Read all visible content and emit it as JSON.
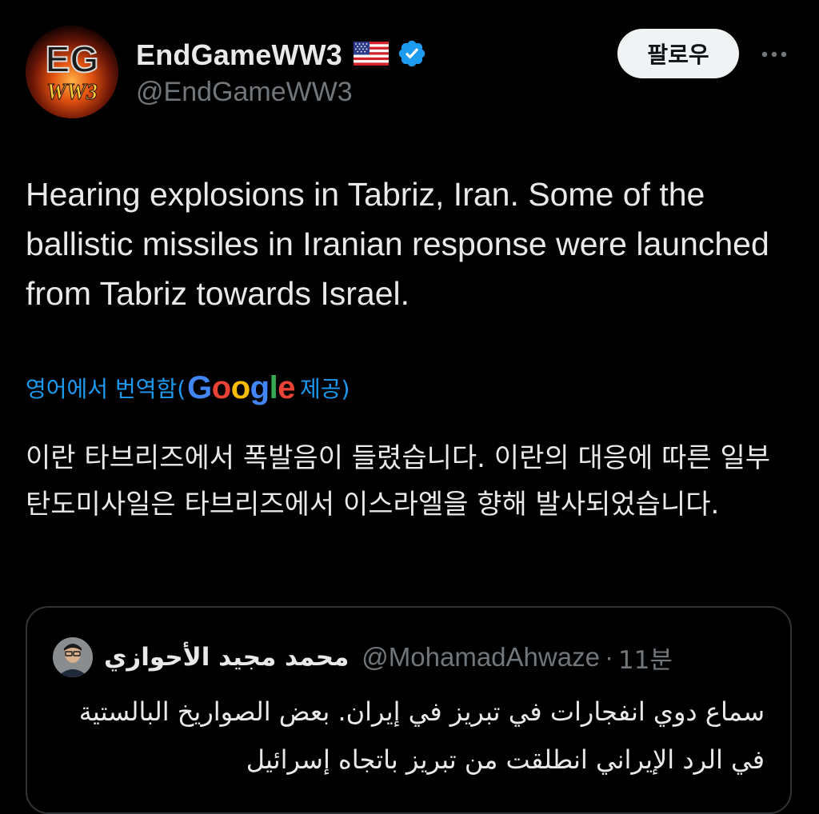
{
  "author": {
    "display_name": "EndGameWW3",
    "handle": "@EndGameWW3",
    "flag_icon": "us-flag-icon",
    "verified_icon": "verified-badge-icon",
    "avatar_text_top": "EG",
    "avatar_text_bottom": "WW3"
  },
  "actions": {
    "follow_label": "팔로우",
    "more_icon": "more-horizontal-icon"
  },
  "tweet": {
    "text": "Hearing explosions in Tabriz, Iran. Some of the ballistic missiles in Iranian response were launched from Tabriz towards Israel.",
    "translation_prefix": "영어에서 번역함(",
    "translation_provider": "Google",
    "translation_suffix": " 제공)",
    "translated_text": "이란 타브리즈에서 폭발음이 들렸습니다. 이란의 대응에 따른 일부 탄도미사일은 타브리즈에서 이스라엘을 향해 발사되었습니다."
  },
  "quote": {
    "display_name": "محمد مجيد الأحوازي",
    "handle": "@MohamadAhwaze",
    "separator": "·",
    "time": "11분",
    "text": "سماع دوي انفجارات في تبريز في إيران. بعض الصواريخ البالستية في الرد الإيراني انطلقت من تبريز باتجاه إسرائيل"
  },
  "colors": {
    "background": "#000000",
    "text": "#e7e9ea",
    "secondary": "#71767b",
    "link": "#1d9bf0",
    "verified": "#1d9bf0",
    "border": "#2f3336",
    "follow_bg": "#eff3f4"
  }
}
